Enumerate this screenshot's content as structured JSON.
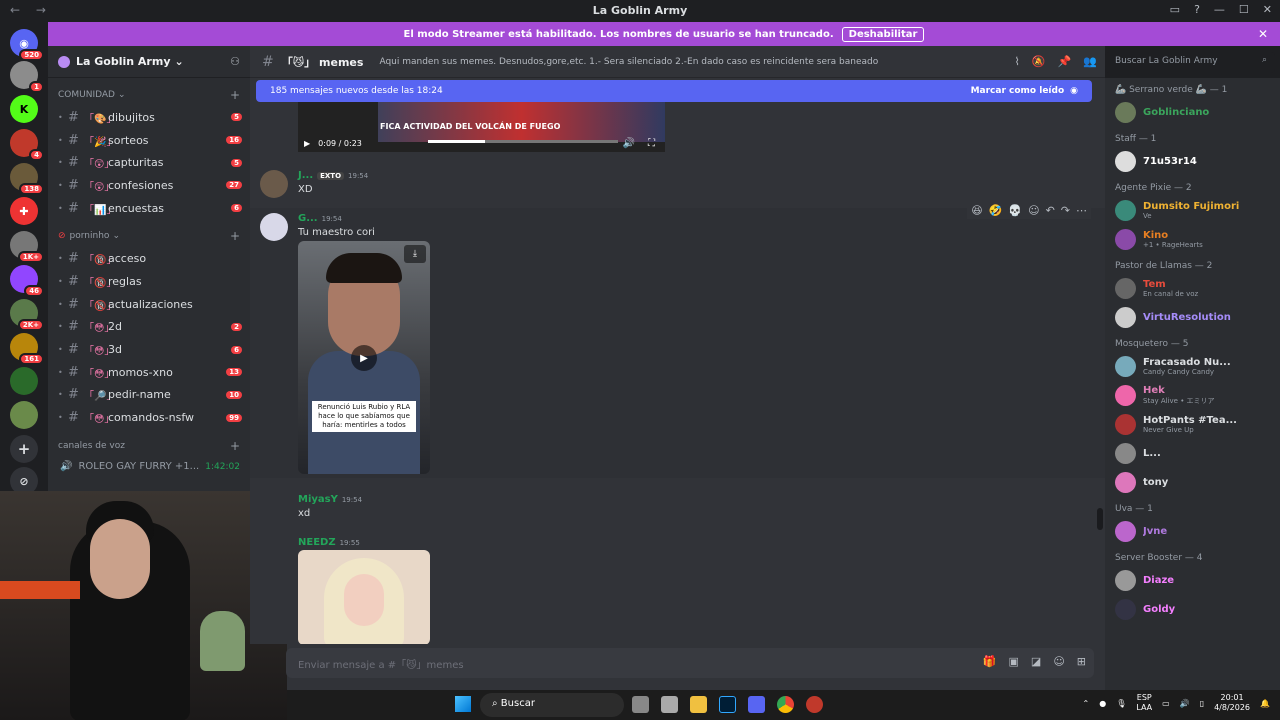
{
  "window": {
    "title": "La Goblin Army",
    "nav_arrows": "←  →"
  },
  "banner": {
    "text": "El modo Streamer está habilitado. Los nombres de usuario se han truncado.",
    "button": "Deshabilitar"
  },
  "rail": {
    "badges": [
      "520",
      "1",
      "4",
      "138",
      "1K+",
      "46",
      "2K+",
      "161"
    ]
  },
  "sidebar": {
    "guild_name": "La Goblin Army",
    "categories": [
      {
        "name": "COMUNIDAD"
      },
      {
        "name": "porninho"
      },
      {
        "name": "canales de voz"
      }
    ],
    "channels_comunidad": [
      {
        "emoji": "「🎨」",
        "name": "dibujitos",
        "count": "5"
      },
      {
        "emoji": "「🎉」",
        "name": "sorteos",
        "count": "16"
      },
      {
        "emoji": "「😲」",
        "name": "capturitas",
        "count": "5"
      },
      {
        "emoji": "「😲」",
        "name": "confesiones",
        "count": "27"
      },
      {
        "emoji": "「📊」",
        "name": "encuestas",
        "count": "6"
      }
    ],
    "channels_porninho": [
      {
        "emoji": "「🔞」",
        "name": "acceso",
        "count": ""
      },
      {
        "emoji": "「🔞」",
        "name": "reglas",
        "count": ""
      },
      {
        "emoji": "「🔞」",
        "name": "actualizaciones",
        "count": ""
      },
      {
        "emoji": "「😳」",
        "name": "2d",
        "count": "2"
      },
      {
        "emoji": "「😳」",
        "name": "3d",
        "count": "6"
      },
      {
        "emoji": "「😳」",
        "name": "momos-xno",
        "count": "13"
      },
      {
        "emoji": "「🔎」",
        "name": "pedir-name",
        "count": "10"
      },
      {
        "emoji": "「😳」",
        "name": "comandos-nsfw",
        "count": "99"
      }
    ],
    "voice": {
      "name": "ROLEO GAY FURRY +1...",
      "time": "1:42:02"
    }
  },
  "chat": {
    "channel_name": "memes",
    "channel_emoji": "「😼」",
    "topic": "Aqui manden sus memes. Desnudos,gore,etc. 1.- Sera silenciado 2.-En dado caso es reincidente sera baneado",
    "search_placeholder": "Buscar La Goblin Army",
    "new_messages": "185 mensajes nuevos desde las 18:24",
    "mark_read": "Marcar como leído",
    "video1": {
      "caption": "FICA ACTIVIDAD DEL VOLCÁN DE FUEGO",
      "time": "0:09 / 0:23"
    },
    "messages": [
      {
        "author": "J...",
        "tag": "EXTO",
        "time": "19:54",
        "text": "XD"
      },
      {
        "author": "G...",
        "time": "19:54",
        "text": "Tu maestro cori",
        "video_caption": "Renunció Luis Rubio y RLA hace lo que sabíamos que haría: mentirles a todos"
      },
      {
        "author": "MiyasY",
        "time": "19:54",
        "text": "xd"
      },
      {
        "author": "NEEDZ",
        "time": "19:55",
        "text": ""
      }
    ],
    "composer_placeholder": "Enviar mensaje a #「😼」memes"
  },
  "members": {
    "groups": [
      {
        "role": "🦾 Serrano verde 🦾 — 1",
        "members": [
          {
            "name": "Goblinciano",
            "status": "",
            "color": "#3ba55c"
          }
        ]
      },
      {
        "role": "Staff — 1",
        "members": [
          {
            "name": "71u53r14",
            "status": "",
            "color": "#ffffff"
          }
        ]
      },
      {
        "role": "Agente Pixie — 2",
        "members": [
          {
            "name": "Dumsito Fujimori",
            "status": "Ve",
            "color": "#f0b232"
          },
          {
            "name": "Kino",
            "status": "+1 • RageHearts",
            "color": "#e67e22"
          }
        ]
      },
      {
        "role": "Pastor de Llamas — 2",
        "members": [
          {
            "name": "Tem",
            "status": "En canal de voz",
            "color": "#e74c3c"
          },
          {
            "name": "VirtuResolution",
            "status": "",
            "color": "#a58cf8"
          }
        ]
      },
      {
        "role": "Mosquetero — 5",
        "members": [
          {
            "name": "Fracasado Nu...",
            "status": "Candy Candy Candy",
            "color": "#dbdee1"
          },
          {
            "name": "Hek",
            "status": "Stay Alive • エミリア",
            "color": "#e07fb8"
          },
          {
            "name": "HotPants #Tea...",
            "status": "Never Give Up",
            "color": "#dbdee1"
          },
          {
            "name": "L...",
            "status": "",
            "color": "#dbdee1"
          },
          {
            "name": "tony",
            "status": "",
            "color": "#dbdee1"
          }
        ]
      },
      {
        "role": "Uva — 1",
        "members": [
          {
            "name": "Jvne",
            "status": "",
            "color": "#b07ae0"
          }
        ]
      },
      {
        "role": "Server Booster — 4",
        "members": [
          {
            "name": "Diaze",
            "status": "",
            "color": "#f47fff"
          },
          {
            "name": "Goldy",
            "status": "",
            "color": "#f47fff"
          }
        ]
      }
    ]
  },
  "taskbar": {
    "search": "Buscar",
    "lang": "ESP",
    "lang2": "LAA",
    "time": "20:01",
    "date": "4/8/2026"
  }
}
